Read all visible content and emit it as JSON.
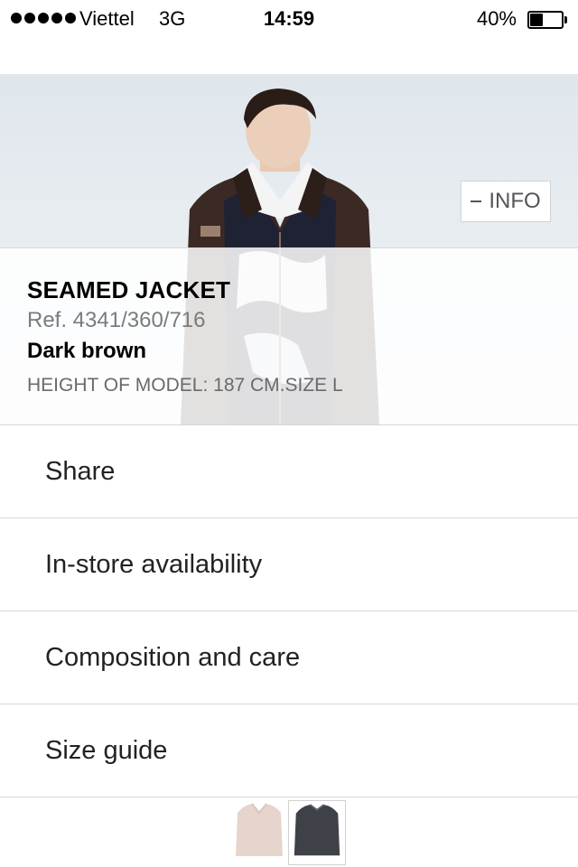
{
  "status_bar": {
    "carrier": "Viettel",
    "network": "3G",
    "time": "14:59",
    "battery_percent": "40%",
    "battery_level": 0.4
  },
  "hero": {
    "info_button_label": "INFO"
  },
  "product": {
    "title": "SEAMED JACKET",
    "reference": "Ref. 4341/360/716",
    "color": "Dark brown",
    "model_height": "HEIGHT OF MODEL: 187 CM.SIZE L"
  },
  "menu": {
    "items": [
      {
        "label": "Share"
      },
      {
        "label": "In-store availability"
      },
      {
        "label": "Composition and care"
      },
      {
        "label": "Size guide"
      }
    ]
  },
  "thumbnails": {
    "selected_index": 1,
    "items": [
      {
        "icon": "jacket-front-thumbnail"
      },
      {
        "icon": "jacket-back-thumbnail"
      }
    ]
  },
  "colors": {
    "jacket": "#3b2a24",
    "background": "#ffffff"
  }
}
